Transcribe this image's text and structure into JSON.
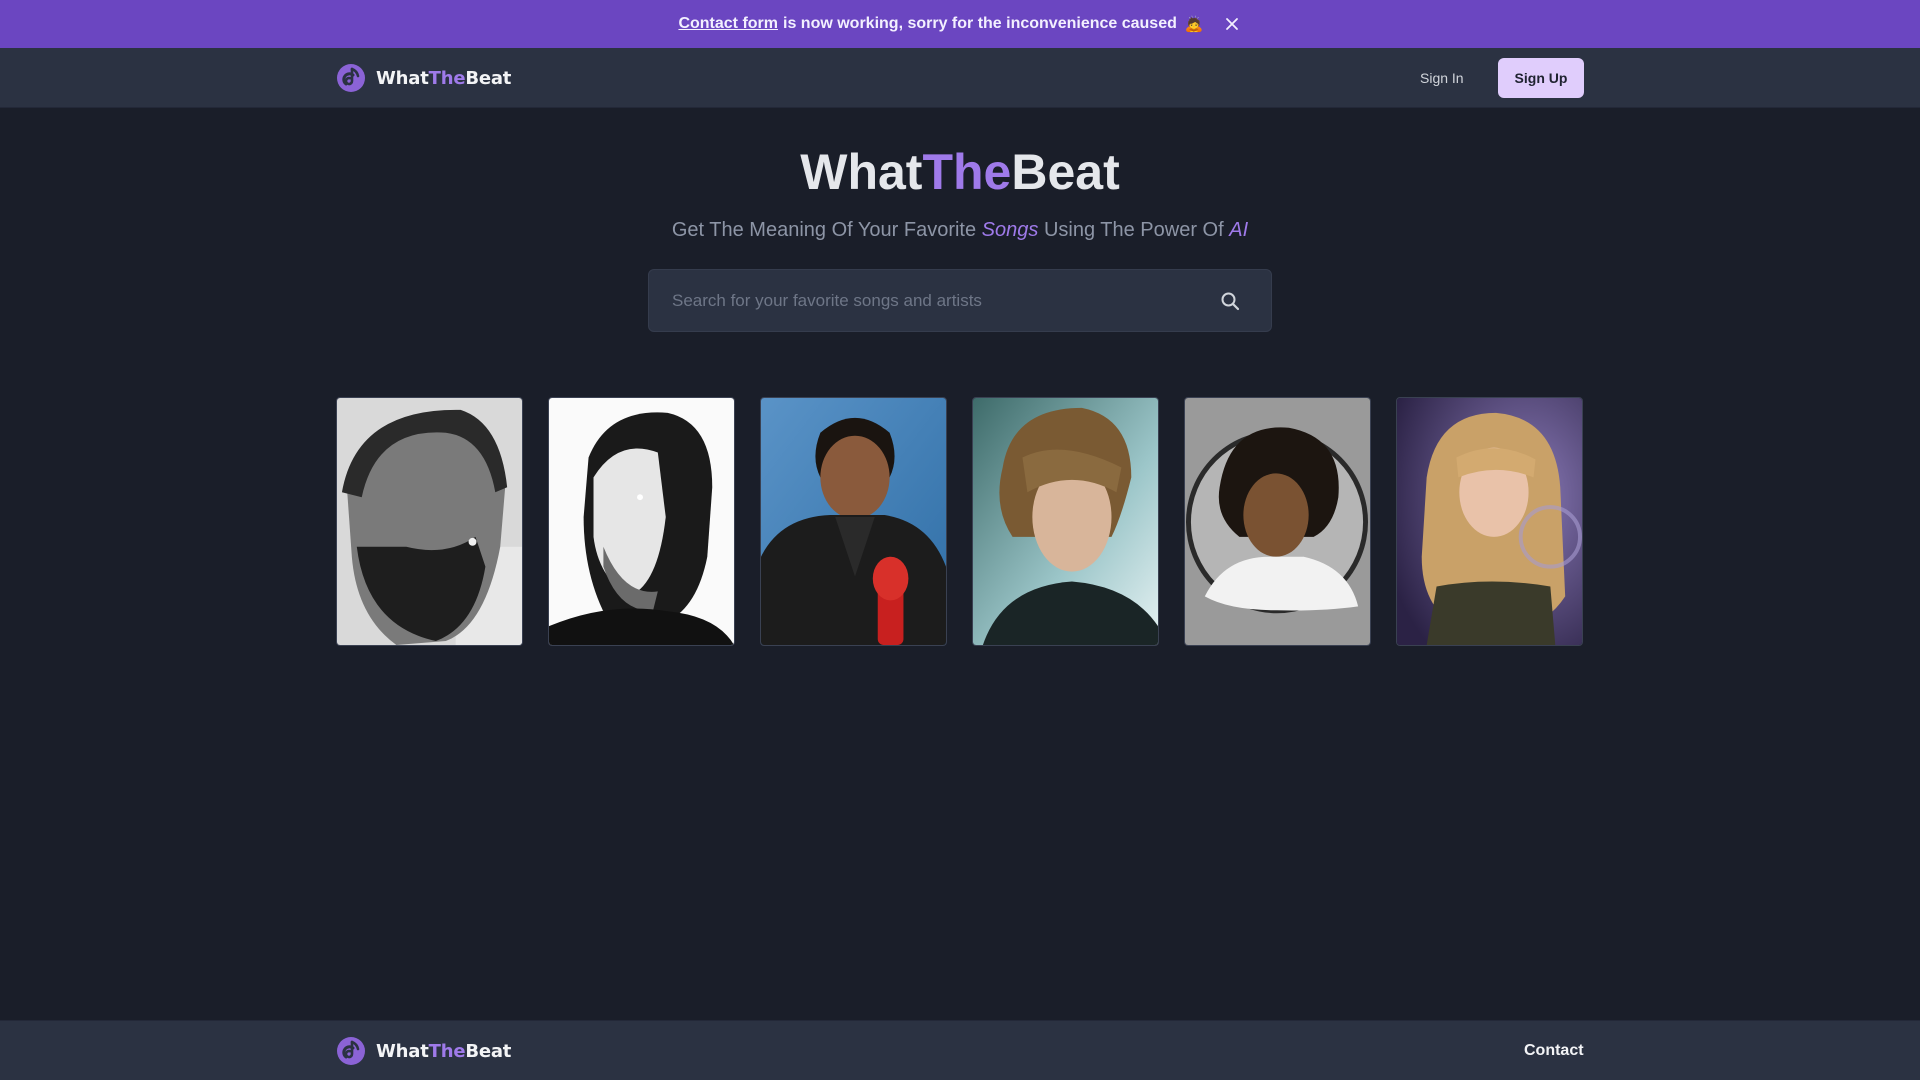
{
  "banner": {
    "link_text": "Contact form",
    "message": "is now working, sorry for the inconvenience caused",
    "emoji": "🙇"
  },
  "header": {
    "brand": {
      "part1": "What",
      "part2": "The",
      "part3": "Beat"
    },
    "sign_in": "Sign In",
    "sign_up": "Sign Up"
  },
  "hero": {
    "title": {
      "part1": "What",
      "part2": "The",
      "part3": "Beat"
    },
    "subtitle": {
      "part1": "Get The Meaning Of Your Favorite",
      "em1": "Songs",
      "part2": "Using The Power Of",
      "em2": "AI"
    }
  },
  "search": {
    "placeholder": "Search for your favorite songs and artists",
    "value": ""
  },
  "footer": {
    "brand": {
      "part1": "What",
      "part2": "The",
      "part3": "Beat"
    },
    "contact": "Contact"
  },
  "colors": {
    "background": "#1a1e29",
    "banner": "#6b46c1",
    "header": "#2b3242",
    "accent": "#9f7aea",
    "sign_up_bg": "#e0cdfc"
  },
  "icons": {
    "logo": "music-note-logo-icon",
    "close": "close-icon",
    "search": "search-icon"
  }
}
